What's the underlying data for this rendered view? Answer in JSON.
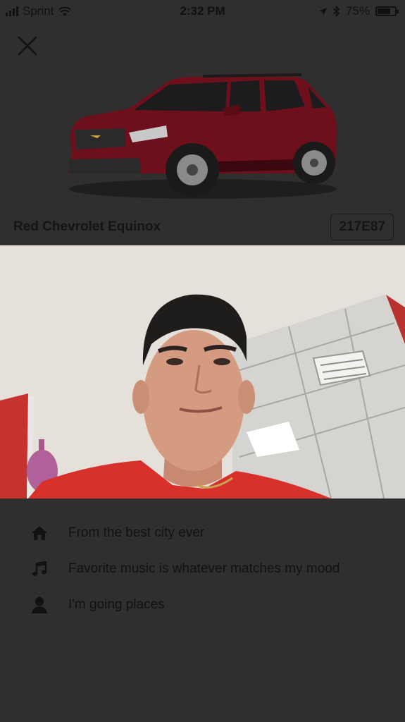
{
  "status_bar": {
    "carrier": "Sprint",
    "time": "2:32 PM",
    "battery_percent": "75%",
    "battery_level": 0.75
  },
  "car": {
    "name": "Red Chevrolet Equinox",
    "plate": "217E87",
    "color": "#6e0f1c"
  },
  "info": [
    {
      "icon": "home-icon",
      "text": "From the best city ever"
    },
    {
      "icon": "music-note-icon",
      "text": "Favorite music is whatever matches my mood"
    },
    {
      "icon": "person-icon",
      "text": "I'm going places"
    }
  ],
  "colors": {
    "background": "#2f2f2f",
    "text": "#121212"
  }
}
